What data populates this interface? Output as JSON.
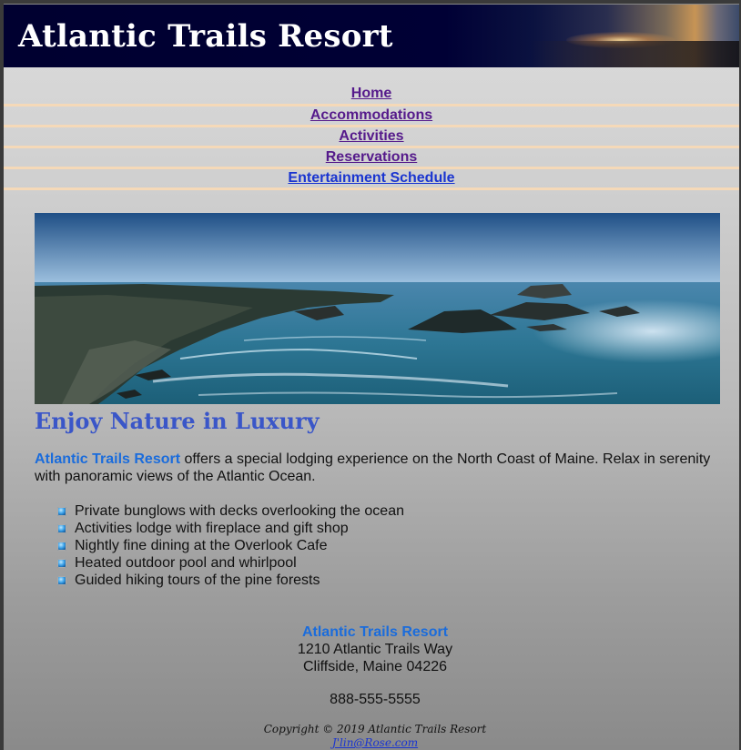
{
  "header": {
    "title": "Atlantic Trails Resort"
  },
  "nav": {
    "items": [
      {
        "label": "Home",
        "visited": true
      },
      {
        "label": "Accommodations",
        "visited": true
      },
      {
        "label": "Activities",
        "visited": true
      },
      {
        "label": "Reservations",
        "visited": true
      },
      {
        "label": "Entertainment Schedule",
        "visited": false
      }
    ]
  },
  "hero": {
    "image": "ocean-coast-photo"
  },
  "main": {
    "heading": "Enjoy Nature in Luxury",
    "intro_brand": "Atlantic Trails Resort",
    "intro_text": " offers a special lodging experience on the North Coast of Maine. Relax in serenity with panoramic views of the Atlantic Ocean.",
    "amenities": [
      "Private bunglows with decks overlooking the ocean",
      "Activities lodge with fireplace and gift shop",
      "Nightly fine dining at the Overlook Cafe",
      "Heated outdoor pool and whirlpool",
      "Guided hiking tours of the pine forests"
    ]
  },
  "contact": {
    "name": "Atlantic Trails Resort",
    "street": "1210 Atlantic Trails Way",
    "city": "Cliffside, Maine 04226",
    "phone": "888-555-5555"
  },
  "copyright": {
    "text": "Copyright © 2019 Atlantic Trails Resort",
    "email": "J'lin@Rose.com"
  },
  "colors": {
    "header_bg": "#000033",
    "link_visited": "#551a8b",
    "link_unvisited": "#1a35d0",
    "heading_blue": "#3a56c8",
    "brand_blue": "#1a6cdc",
    "nav_divider": "#f5d9b8"
  }
}
